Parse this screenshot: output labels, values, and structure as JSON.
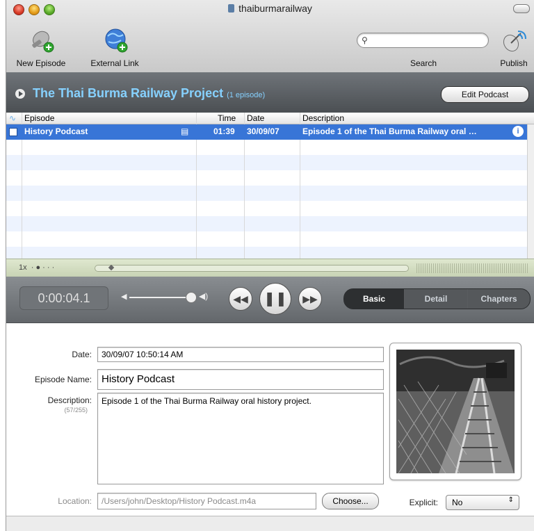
{
  "window": {
    "title": "thaiburmarailway"
  },
  "toolbar": {
    "new_episode_label": "New Episode",
    "external_link_label": "External Link",
    "search_label": "Search",
    "search_value": "",
    "publish_label": "Publish"
  },
  "podcast": {
    "title": "The Thai Burma Railway Project",
    "count": "(1 episode)",
    "edit_label": "Edit Podcast"
  },
  "table": {
    "headers": {
      "episode": "Episode",
      "time": "Time",
      "date": "Date",
      "description": "Description"
    },
    "rows": [
      {
        "episode": "History Podcast",
        "time": "01:39",
        "date": "30/09/07",
        "description": "Episode 1 of the Thai Burma Railway oral …"
      }
    ]
  },
  "scrubber": {
    "speed": "1x"
  },
  "player": {
    "time": "0:00:04.1",
    "tabs": [
      "Basic",
      "Detail",
      "Chapters"
    ],
    "active_tab": "Basic"
  },
  "details": {
    "date_label": "Date:",
    "date_value": "30/09/07 10:50:14 AM",
    "name_label": "Episode Name:",
    "name_value": "History Podcast",
    "description_label": "Description:",
    "description_count": "(57/255)",
    "description_value": "Episode 1 of the Thai Burma Railway oral history project.",
    "location_label": "Location:",
    "location_value": "/Users/john/Desktop/History Podcast.m4a",
    "choose_label": "Choose...",
    "explicit_label": "Explicit:",
    "explicit_value": "No"
  },
  "colors": {
    "accent_selection": "#3875d7",
    "podcast_title": "#86d1ff",
    "segmented_active": "#3b3d40"
  }
}
